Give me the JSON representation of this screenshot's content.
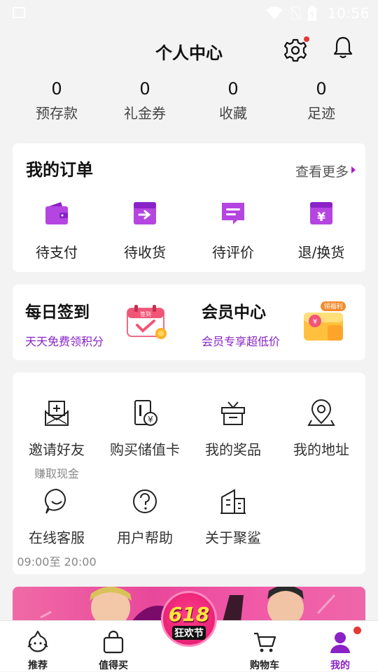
{
  "status_bar": {
    "time": "10:56"
  },
  "header": {
    "title": "个人中心"
  },
  "stats": [
    {
      "value": "0",
      "label": "预存款"
    },
    {
      "value": "0",
      "label": "礼金券"
    },
    {
      "value": "0",
      "label": "收藏"
    },
    {
      "value": "0",
      "label": "足迹"
    }
  ],
  "orders": {
    "title": "我的订单",
    "more": "查看更多",
    "items": [
      {
        "label": "待支付",
        "icon": "wallet-icon"
      },
      {
        "label": "待收货",
        "icon": "receive-box-icon"
      },
      {
        "label": "待评价",
        "icon": "comment-icon"
      },
      {
        "label": "退/换货",
        "icon": "refund-yen-icon"
      }
    ]
  },
  "promos": {
    "signin": {
      "title": "每日签到",
      "subtitle": "天天免费领积分",
      "tag": "签到"
    },
    "member": {
      "title": "会员中心",
      "subtitle": "会员专享超低价",
      "tag": "领福利"
    }
  },
  "services": [
    {
      "label": "邀请好友",
      "sub": "赚取现金",
      "icon": "invite-mail-icon"
    },
    {
      "label": "购买储值卡",
      "sub": "",
      "icon": "stored-value-card-icon"
    },
    {
      "label": "我的奖品",
      "sub": "",
      "icon": "gift-box-icon"
    },
    {
      "label": "我的地址",
      "sub": "",
      "icon": "location-pin-icon"
    },
    {
      "label": "在线客服",
      "sub": "09:00至 20:00",
      "icon": "chat-service-icon"
    },
    {
      "label": "用户帮助",
      "sub": "",
      "icon": "help-question-icon"
    },
    {
      "label": "关于聚鲨",
      "sub": "",
      "icon": "building-icon"
    }
  ],
  "tabbar": {
    "items": [
      {
        "label": "推荐",
        "icon": "shark-icon"
      },
      {
        "label": "值得买",
        "icon": "shopping-bag-icon"
      },
      {
        "label": "狂欢节",
        "icon": "618-badge"
      },
      {
        "label": "购物车",
        "icon": "cart-icon"
      },
      {
        "label": "我的",
        "icon": "person-icon"
      }
    ],
    "center_badge_text": "618",
    "active": "我的"
  },
  "colors": {
    "accent": "#8a22c7",
    "background": "#f3f3f3",
    "badge_red": "#e53935"
  }
}
